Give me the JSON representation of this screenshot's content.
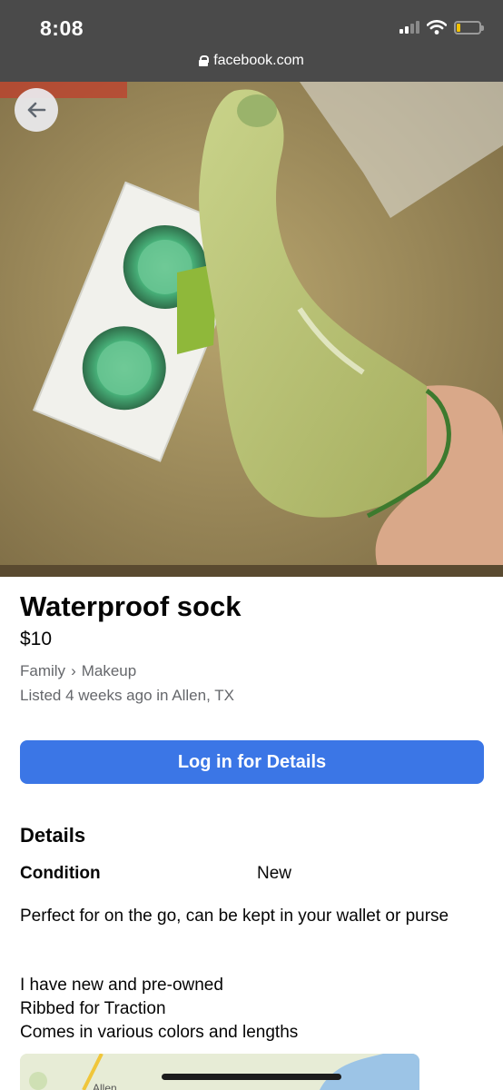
{
  "status_bar": {
    "time": "8:08"
  },
  "browser": {
    "url": "facebook.com"
  },
  "listing": {
    "title": "Waterproof sock",
    "price": "$10",
    "category_parent": "Family",
    "category_separator": "›",
    "category": "Makeup",
    "listed": "Listed 4 weeks ago in Allen, TX",
    "cta_label": "Log in for Details"
  },
  "details": {
    "heading": "Details",
    "condition_label": "Condition",
    "condition_value": "New",
    "description_lines": [
      "Perfect for on the go, can be kept in your wallet or purse",
      "I have new and pre-owned",
      "Ribbed for Traction",
      "Comes in various colors and lengths"
    ]
  },
  "map": {
    "label": "Allen"
  },
  "colors": {
    "accent": "#3b76e6",
    "chrome": "#4a4a4a",
    "secondary_text": "#65676b"
  },
  "icons": [
    "lock-icon",
    "signal-icon",
    "wifi-icon",
    "battery-icon",
    "back-arrow-icon"
  ]
}
